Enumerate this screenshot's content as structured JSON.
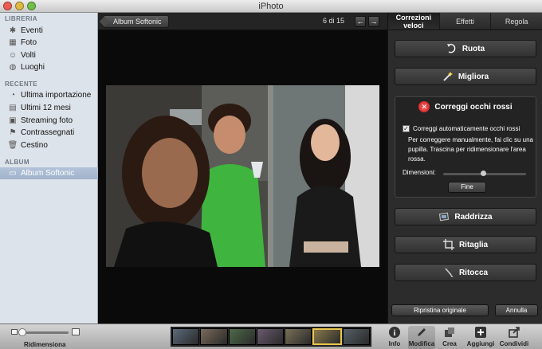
{
  "window": {
    "title": "iPhoto"
  },
  "sidebar": {
    "sections": [
      {
        "title": "LIBRERIA",
        "items": [
          {
            "label": "Eventi",
            "icon": "events-icon"
          },
          {
            "label": "Foto",
            "icon": "photos-icon"
          },
          {
            "label": "Volti",
            "icon": "faces-icon"
          },
          {
            "label": "Luoghi",
            "icon": "places-icon"
          }
        ]
      },
      {
        "title": "RECENTE",
        "items": [
          {
            "label": "Ultima importazione",
            "icon": "import-icon"
          },
          {
            "label": "Ultimi 12 mesi",
            "icon": "calendar-icon"
          },
          {
            "label": "Streaming foto",
            "icon": "photostream-icon"
          },
          {
            "label": "Contrassegnati",
            "icon": "flag-icon"
          },
          {
            "label": "Cestino",
            "icon": "trash-icon"
          }
        ]
      },
      {
        "title": "ALBUM",
        "items": [
          {
            "label": "Album Softonic",
            "icon": "album-icon",
            "selected": true
          }
        ]
      }
    ]
  },
  "viewer": {
    "back_label": "Album Softonic",
    "counter": "6 di 15",
    "prev_symbol": "←",
    "next_symbol": "→"
  },
  "panel": {
    "tabs": [
      {
        "label": "Correzioni veloci",
        "active": true
      },
      {
        "label": "Effetti",
        "active": false
      },
      {
        "label": "Regola",
        "active": false
      }
    ],
    "rotate_label": "Ruota",
    "enhance_label": "Migliora",
    "redeye": {
      "title": "Correggi occhi rossi",
      "auto_label": "Correggi automaticamente occhi rossi",
      "auto_checked": true,
      "help_text": "Per correggere manualmente, fai clic su una pupilla. Trascina per ridimensionare l'area rossa.",
      "size_label": "Dimensioni:",
      "size_value": 0.45,
      "done_label": "Fine"
    },
    "straighten_label": "Raddrizza",
    "crop_label": "Ritaglia",
    "retouch_label": "Ritocca",
    "revert_label": "Ripristina originale",
    "cancel_label": "Annulla"
  },
  "toolbar": {
    "zoom_label": "Ridimensiona",
    "zoom_value": 0.0,
    "thumbnails": 7,
    "selected_thumbnail": 6,
    "tools": [
      {
        "label": "Info",
        "icon": "info-icon"
      },
      {
        "label": "Modifica",
        "icon": "edit-icon",
        "active": true
      },
      {
        "label": "Crea",
        "icon": "create-icon"
      },
      {
        "label": "Aggiungi a",
        "icon": "add-icon"
      },
      {
        "label": "Condividi",
        "icon": "share-icon"
      }
    ]
  },
  "colors": {
    "panel_bg": "#2c2c2c",
    "sidebar_bg": "#dde3ea",
    "selection": "#a9bbd2",
    "redeye_icon": "#d41919"
  }
}
